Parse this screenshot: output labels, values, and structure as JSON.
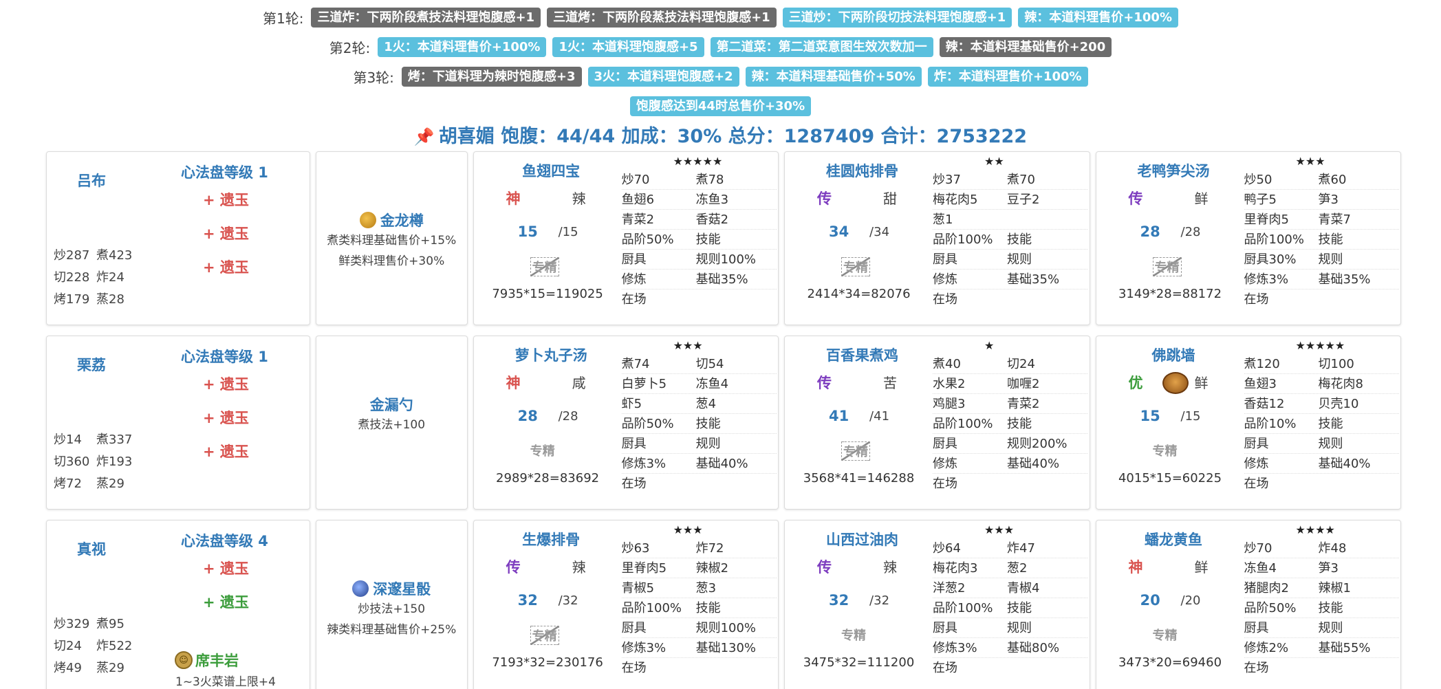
{
  "rounds": [
    {
      "label": "第1轮:",
      "tags": [
        {
          "text": "三道炸：下两阶段煮技法料理饱腹感+1",
          "color": "gray"
        },
        {
          "text": "三道烤：下两阶段蒸技法料理饱腹感+1",
          "color": "gray"
        },
        {
          "text": "三道炒：下两阶段切技法料理饱腹感+1",
          "color": "blue"
        },
        {
          "text": "辣：本道料理售价+100%",
          "color": "blue"
        }
      ]
    },
    {
      "label": "第2轮:",
      "tags": [
        {
          "text": "1火：本道料理售价+100%",
          "color": "blue"
        },
        {
          "text": "1火：本道料理饱腹感+5",
          "color": "blue"
        },
        {
          "text": "第二道菜：第二道菜意图生效次数加一",
          "color": "blue"
        },
        {
          "text": "辣：本道料理基础售价+200",
          "color": "gray"
        }
      ]
    },
    {
      "label": "第3轮:",
      "tags": [
        {
          "text": "烤：下道料理为辣时饱腹感+3",
          "color": "gray"
        },
        {
          "text": "3火：本道料理饱腹感+2",
          "color": "blue"
        },
        {
          "text": "辣：本道料理基础售价+50%",
          "color": "blue"
        },
        {
          "text": "炸：本道料理售价+100%",
          "color": "blue"
        }
      ]
    },
    {
      "label": "",
      "tags": [
        {
          "text": "饱腹感达到44时总售价+30%",
          "color": "blue"
        }
      ]
    }
  ],
  "summary": {
    "icon": "pin-icon",
    "text": "胡喜媚 饱腹：44/44 加成：30% 总分：1287409 合计：2753222"
  },
  "colors": {
    "accent_blue": "#337ab7",
    "tag_blue": "#5bc0de",
    "tag_gray": "#6c6c6c",
    "rank_shen": "#d9534f",
    "rank_chuan": "#7d3cbf",
    "rank_you": "#3c9d3c"
  },
  "rows": [
    {
      "chef": {
        "name": "吕布",
        "disk": "心法盘等级 1",
        "slots": [
          {
            "text": "+ 遗玉",
            "color": "red"
          },
          {
            "text": "+ 遗玉",
            "color": "red"
          },
          {
            "text": "+ 遗玉",
            "color": "red"
          }
        ],
        "stats": [
          [
            "炒287",
            "煮423"
          ],
          [
            "切228",
            "炸24"
          ],
          [
            "烤179",
            "蒸28"
          ]
        ],
        "partner": null
      },
      "equip": {
        "name": "金龙樽",
        "icon": "gold",
        "effects": [
          "煮类料理基础售价+15%",
          "鲜类料理售价+30%"
        ]
      },
      "recipes": [
        {
          "name": "鱼翅四宝",
          "stars": "★★★★★",
          "rank": "神",
          "rank_class": "shen",
          "taste": "辣",
          "qty": "15",
          "max": "/15",
          "special": "专精",
          "special_struck": true,
          "formula": "7935*15=119025",
          "has_dish_icon": false,
          "table": [
            [
              "炒70",
              "煮78"
            ],
            [
              "鱼翅6",
              "冻鱼3"
            ],
            [
              "青菜2",
              "香菇2"
            ],
            [
              "品阶50%",
              "技能"
            ],
            [
              "厨具",
              "规则100%"
            ],
            [
              "修炼",
              "基础35%"
            ],
            [
              "在场",
              ""
            ]
          ]
        },
        {
          "name": "桂圆炖排骨",
          "stars": "★★",
          "rank": "传",
          "rank_class": "chuan",
          "taste": "甜",
          "qty": "34",
          "max": "/34",
          "special": "专精",
          "special_struck": true,
          "formula": "2414*34=82076",
          "has_dish_icon": false,
          "table": [
            [
              "炒37",
              "煮70"
            ],
            [
              "梅花肉5",
              "豆子2"
            ],
            [
              "葱1",
              ""
            ],
            [
              "品阶100%",
              "技能"
            ],
            [
              "厨具",
              "规则"
            ],
            [
              "修炼",
              "基础35%"
            ],
            [
              "在场",
              ""
            ]
          ]
        },
        {
          "name": "老鸭笋尖汤",
          "stars": "★★★",
          "rank": "传",
          "rank_class": "chuan",
          "taste": "鲜",
          "qty": "28",
          "max": "/28",
          "special": "专精",
          "special_struck": true,
          "formula": "3149*28=88172",
          "has_dish_icon": false,
          "table": [
            [
              "炒50",
              "煮60"
            ],
            [
              "鸭子5",
              "笋3"
            ],
            [
              "里脊肉5",
              "青菜7"
            ],
            [
              "品阶100%",
              "技能"
            ],
            [
              "厨具30%",
              "规则"
            ],
            [
              "修炼3%",
              "基础35%"
            ],
            [
              "在场",
              ""
            ]
          ]
        }
      ]
    },
    {
      "chef": {
        "name": "栗荔",
        "disk": "心法盘等级 1",
        "slots": [
          {
            "text": "+ 遗玉",
            "color": "red"
          },
          {
            "text": "+ 遗玉",
            "color": "red"
          },
          {
            "text": "+ 遗玉",
            "color": "red"
          }
        ],
        "stats": [
          [
            "炒14",
            "煮337"
          ],
          [
            "切360",
            "炸193"
          ],
          [
            "烤72",
            "蒸29"
          ]
        ],
        "partner": null
      },
      "equip": {
        "name": "金漏勺",
        "icon": "",
        "effects": [
          "煮技法+100"
        ]
      },
      "recipes": [
        {
          "name": "萝卜丸子汤",
          "stars": "★★★",
          "rank": "神",
          "rank_class": "shen",
          "taste": "咸",
          "qty": "28",
          "max": "/28",
          "special": "专精",
          "special_struck": false,
          "formula": "2989*28=83692",
          "has_dish_icon": false,
          "table": [
            [
              "煮74",
              "切54"
            ],
            [
              "白萝卜5",
              "冻鱼4"
            ],
            [
              "虾5",
              "葱4"
            ],
            [
              "品阶50%",
              "技能"
            ],
            [
              "厨具",
              "规则"
            ],
            [
              "修炼3%",
              "基础40%"
            ],
            [
              "在场",
              ""
            ]
          ]
        },
        {
          "name": "百香果煮鸡",
          "stars": "★",
          "rank": "传",
          "rank_class": "chuan",
          "taste": "苦",
          "qty": "41",
          "max": "/41",
          "special": "专精",
          "special_struck": true,
          "formula": "3568*41=146288",
          "has_dish_icon": false,
          "table": [
            [
              "煮40",
              "切24"
            ],
            [
              "水果2",
              "咖喱2"
            ],
            [
              "鸡腿3",
              "青菜2"
            ],
            [
              "品阶100%",
              "技能"
            ],
            [
              "厨具",
              "规则200%"
            ],
            [
              "修炼",
              "基础40%"
            ],
            [
              "在场",
              ""
            ]
          ]
        },
        {
          "name": "佛跳墙",
          "stars": "★★★★★",
          "rank": "优",
          "rank_class": "you",
          "taste": "鲜",
          "qty": "15",
          "max": "/15",
          "special": "专精",
          "special_struck": false,
          "formula": "4015*15=60225",
          "has_dish_icon": true,
          "table": [
            [
              "煮120",
              "切100"
            ],
            [
              "鱼翅3",
              "梅花肉8"
            ],
            [
              "香菇12",
              "贝壳10"
            ],
            [
              "品阶10%",
              "技能"
            ],
            [
              "厨具",
              "规则"
            ],
            [
              "修炼",
              "基础40%"
            ],
            [
              "在场",
              ""
            ]
          ]
        }
      ]
    },
    {
      "chef": {
        "name": "真视",
        "disk": "心法盘等级 4",
        "slots": [
          {
            "text": "+ 遗玉",
            "color": "red"
          },
          {
            "text": "+ 遗玉",
            "color": "green"
          }
        ],
        "stats": [
          [
            "炒329",
            "煮95"
          ],
          [
            "切24",
            "炸522"
          ],
          [
            "烤49",
            "蒸29"
          ]
        ],
        "partner": {
          "name": "席丰岩",
          "effect": "1~3火菜谱上限+4"
        }
      },
      "equip": {
        "name": "深邃星骰",
        "icon": "star",
        "effects": [
          "炒技法+150",
          "辣类料理基础售价+25%"
        ]
      },
      "recipes": [
        {
          "name": "生爆排骨",
          "stars": "★★★",
          "rank": "传",
          "rank_class": "chuan",
          "taste": "辣",
          "qty": "32",
          "max": "/32",
          "special": "专精",
          "special_struck": true,
          "formula": "7193*32=230176",
          "has_dish_icon": false,
          "table": [
            [
              "炒63",
              "炸72"
            ],
            [
              "里脊肉5",
              "辣椒2"
            ],
            [
              "青椒5",
              "葱3"
            ],
            [
              "品阶100%",
              "技能"
            ],
            [
              "厨具",
              "规则100%"
            ],
            [
              "修炼3%",
              "基础130%"
            ],
            [
              "在场",
              ""
            ]
          ]
        },
        {
          "name": "山西过油肉",
          "stars": "★★★",
          "rank": "传",
          "rank_class": "chuan",
          "taste": "辣",
          "qty": "32",
          "max": "/32",
          "special": "专精",
          "special_struck": false,
          "formula": "3475*32=111200",
          "has_dish_icon": false,
          "table": [
            [
              "炒64",
              "炸47"
            ],
            [
              "梅花肉3",
              "葱2"
            ],
            [
              "洋葱2",
              "青椒4"
            ],
            [
              "品阶100%",
              "技能"
            ],
            [
              "厨具",
              "规则"
            ],
            [
              "修炼3%",
              "基础80%"
            ],
            [
              "在场",
              ""
            ]
          ]
        },
        {
          "name": "蟠龙黄鱼",
          "stars": "★★★★",
          "rank": "神",
          "rank_class": "shen",
          "taste": "鲜",
          "qty": "20",
          "max": "/20",
          "special": "专精",
          "special_struck": false,
          "formula": "3473*20=69460",
          "has_dish_icon": false,
          "table": [
            [
              "炒70",
              "炸48"
            ],
            [
              "冻鱼4",
              "笋3"
            ],
            [
              "猪腿肉2",
              "辣椒1"
            ],
            [
              "品阶50%",
              "技能"
            ],
            [
              "厨具",
              "规则"
            ],
            [
              "修炼2%",
              "基础55%"
            ],
            [
              "在场",
              ""
            ]
          ]
        }
      ]
    }
  ]
}
